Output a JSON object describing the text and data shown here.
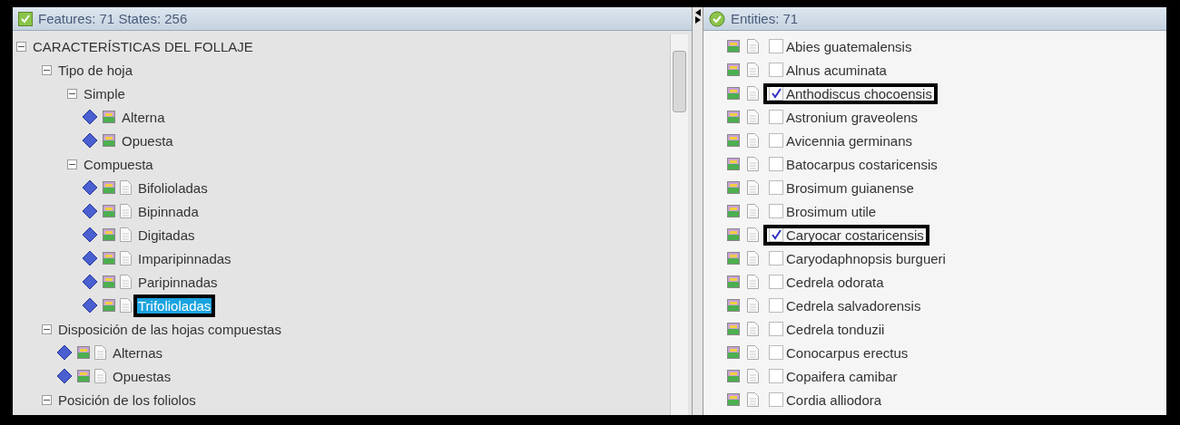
{
  "features_panel": {
    "title": "Features: 71 States: 256",
    "tree": [
      {
        "label": "CARACTERÍSTICAS DEL FOLLAJE",
        "kind": "group",
        "expanded": true,
        "children": [
          {
            "label": "Tipo de hoja",
            "kind": "group",
            "expanded": true,
            "children": [
              {
                "label": "Simple",
                "kind": "group",
                "expanded": true,
                "children": [
                  {
                    "label": "Alterna",
                    "kind": "state",
                    "has_document": false,
                    "selected": false,
                    "highlighted": false
                  },
                  {
                    "label": "Opuesta",
                    "kind": "state",
                    "has_document": false,
                    "selected": false,
                    "highlighted": false
                  }
                ]
              },
              {
                "label": "Compuesta",
                "kind": "group",
                "expanded": true,
                "children": [
                  {
                    "label": "Bifolioladas",
                    "kind": "state",
                    "has_document": true,
                    "selected": false,
                    "highlighted": false
                  },
                  {
                    "label": "Bipinnada",
                    "kind": "state",
                    "has_document": true,
                    "selected": false,
                    "highlighted": false
                  },
                  {
                    "label": "Digitadas",
                    "kind": "state",
                    "has_document": true,
                    "selected": false,
                    "highlighted": false
                  },
                  {
                    "label": "Imparipinnadas",
                    "kind": "state",
                    "has_document": true,
                    "selected": false,
                    "highlighted": false
                  },
                  {
                    "label": "Paripinnadas",
                    "kind": "state",
                    "has_document": true,
                    "selected": false,
                    "highlighted": false
                  },
                  {
                    "label": "Trifolioladas",
                    "kind": "state",
                    "has_document": true,
                    "selected": true,
                    "highlighted": true
                  }
                ]
              }
            ]
          },
          {
            "label": "Disposición de las hojas compuestas",
            "kind": "group",
            "expanded": true,
            "children": [
              {
                "label": "Alternas",
                "kind": "state",
                "has_document": true,
                "selected": false,
                "highlighted": false
              },
              {
                "label": "Opuestas",
                "kind": "state",
                "has_document": true,
                "selected": false,
                "highlighted": false
              }
            ]
          },
          {
            "label": "Posición de los foliolos",
            "kind": "group",
            "expanded": true
          }
        ]
      }
    ]
  },
  "entities_panel": {
    "title": "Entities: 71",
    "items": [
      {
        "label": "Abies guatemalensis",
        "checked": false,
        "highlighted": false
      },
      {
        "label": "Alnus acuminata",
        "checked": false,
        "highlighted": false
      },
      {
        "label": "Anthodiscus chocoensis",
        "checked": true,
        "highlighted": true
      },
      {
        "label": "Astronium graveolens",
        "checked": false,
        "highlighted": false
      },
      {
        "label": "Avicennia germinans",
        "checked": false,
        "highlighted": false
      },
      {
        "label": "Batocarpus costaricensis",
        "checked": false,
        "highlighted": false
      },
      {
        "label": "Brosimum guianense",
        "checked": false,
        "highlighted": false
      },
      {
        "label": "Brosimum utile",
        "checked": false,
        "highlighted": false
      },
      {
        "label": "Caryocar costaricensis",
        "checked": true,
        "highlighted": true
      },
      {
        "label": "Caryodaphnopsis burgueri",
        "checked": false,
        "highlighted": false
      },
      {
        "label": "Cedrela odorata",
        "checked": false,
        "highlighted": false
      },
      {
        "label": "Cedrela salvadorensis",
        "checked": false,
        "highlighted": false
      },
      {
        "label": "Cedrela tonduzii",
        "checked": false,
        "highlighted": false
      },
      {
        "label": "Conocarpus erectus",
        "checked": false,
        "highlighted": false
      },
      {
        "label": "Copaifera camibar",
        "checked": false,
        "highlighted": false
      },
      {
        "label": "Cordia alliodora",
        "checked": false,
        "highlighted": false
      }
    ]
  }
}
